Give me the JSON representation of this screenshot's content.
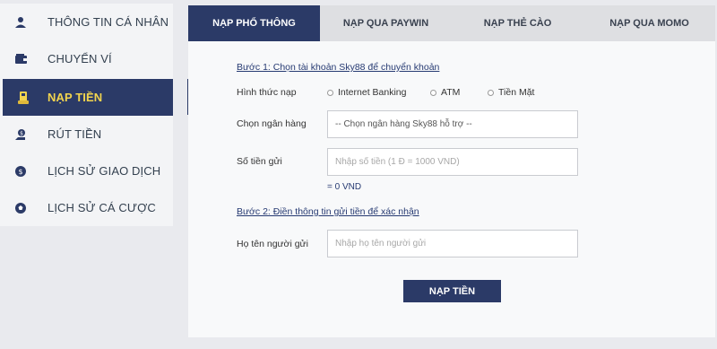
{
  "sidebar": {
    "items": [
      {
        "label": "THÔNG TIN CÁ NHÂN",
        "icon": "user-icon"
      },
      {
        "label": "CHUYỂN VÍ",
        "icon": "wallet-icon"
      },
      {
        "label": "NẠP TIỀN",
        "icon": "deposit-icon"
      },
      {
        "label": "RÚT TIỀN",
        "icon": "withdraw-icon"
      },
      {
        "label": "LỊCH SỬ GIAO DỊCH",
        "icon": "coin-icon"
      },
      {
        "label": "LỊCH SỬ CÁ CƯỢC",
        "icon": "soccer-ball-icon"
      }
    ],
    "active_index": 2
  },
  "tabs": [
    {
      "label": "NẠP PHỔ THÔNG"
    },
    {
      "label": "NẠP QUA PAYWIN"
    },
    {
      "label": "NẠP THẺ CÀO"
    },
    {
      "label": "NẠP QUA MOMO"
    }
  ],
  "form": {
    "step1": "Bước 1: Chọn tài khoản Sky88 để chuyển khoản",
    "method_label": "Hình thức nạp",
    "methods": [
      "Internet Banking",
      "ATM",
      "Tiền Mặt"
    ],
    "bank_label": "Chọn ngân hàng",
    "bank_select": "-- Chọn ngân hàng Sky88 hỗ trợ --",
    "amount_label": "Số tiền gửi",
    "amount_placeholder": "Nhập số tiền (1 Đ = 1000 VND)",
    "amount_equals": "= 0 VND",
    "step2": "Bước 2: Điền thông tin gửi tiền để xác nhận",
    "sender_label": "Họ tên người gửi",
    "sender_placeholder": "Nhập họ tên người gửi",
    "submit": "NẠP TIỀN"
  },
  "colors": {
    "accent": "#2b3a67",
    "active_text": "#f2d44e",
    "background": "#e9eaee"
  }
}
